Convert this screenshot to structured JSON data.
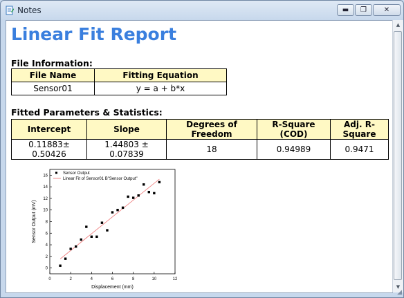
{
  "window": {
    "title": "Notes",
    "minimize_symbol": "▬",
    "restore_symbol": "❐",
    "close_symbol": "✕"
  },
  "report": {
    "title": "Linear Fit Report",
    "file_info": {
      "heading": "File Information:",
      "headers": [
        "File Name",
        "Fitting Equation"
      ],
      "row": [
        "Sensor01",
        "y = a + b*x"
      ]
    },
    "params": {
      "heading": "Fitted Parameters & Statistics:",
      "headers": [
        "Intercept",
        "Slope",
        "Degrees of Freedom",
        "R-Square (COD)",
        "Adj. R-Square"
      ],
      "row": [
        "0.11883± 0.50426",
        "1.44803 ± 0.07839",
        "18",
        "0.94989",
        "0.9471"
      ]
    }
  },
  "chart_data": {
    "type": "scatter",
    "xlabel": "Displacement (mm)",
    "ylabel": "Sensor Output (mV)",
    "xlim": [
      0,
      12
    ],
    "ylim": [
      -1,
      17
    ],
    "xticks": [
      0,
      2,
      4,
      6,
      8,
      10,
      12
    ],
    "yticks": [
      0,
      2,
      4,
      6,
      8,
      10,
      12,
      14,
      16
    ],
    "grid": false,
    "legend_position": "top-left",
    "series": [
      {
        "name": "Sensor Output",
        "kind": "points",
        "color": "#000000",
        "x": [
          1.0,
          1.5,
          2.0,
          2.5,
          3.0,
          3.5,
          4.0,
          4.5,
          5.0,
          5.5,
          6.0,
          6.5,
          7.0,
          7.5,
          8.0,
          8.5,
          9.0,
          9.5,
          10.0,
          10.5
        ],
        "y": [
          0.4,
          1.6,
          3.3,
          3.7,
          4.9,
          7.1,
          5.4,
          5.4,
          7.8,
          6.5,
          9.6,
          10.0,
          10.4,
          12.3,
          12.1,
          12.5,
          14.4,
          13.1,
          12.9,
          14.8
        ]
      },
      {
        "name": "Linear Fit of Sensor01 B\"Sensor Output\"",
        "kind": "line",
        "color": "#f08080",
        "intercept": 0.11883,
        "slope": 1.44803,
        "x_range": [
          1.0,
          10.5
        ]
      }
    ]
  }
}
